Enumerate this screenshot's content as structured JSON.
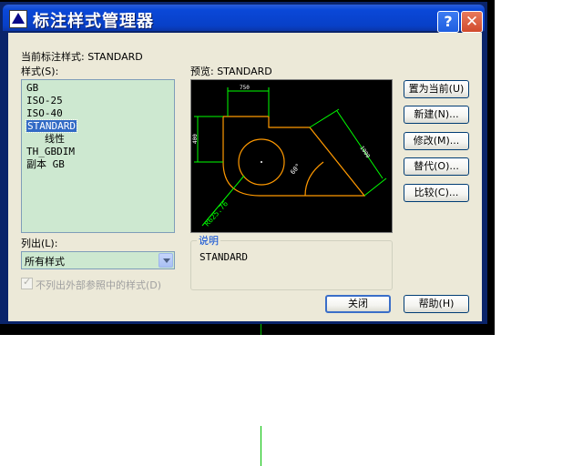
{
  "window": {
    "title": "标注样式管理器",
    "help_glyph": "?",
    "close_glyph": "✕"
  },
  "current_style": {
    "label": "当前标注样式: STANDARD"
  },
  "styles": {
    "label": "样式(S):",
    "items": [
      {
        "text": "GB"
      },
      {
        "text": "ISO-25"
      },
      {
        "text": "ISO-40"
      },
      {
        "text": "STANDARD",
        "selected": true
      },
      {
        "text": "线性",
        "child": true
      },
      {
        "text": "TH_GBDIM"
      },
      {
        "text": "副本 GB"
      }
    ]
  },
  "list_filter": {
    "label": "列出(L):",
    "selected": "所有样式"
  },
  "exclude_xref": {
    "label": "不列出外部参照中的样式(D)",
    "checked": true,
    "enabled": false
  },
  "preview": {
    "label": "预览: STANDARD",
    "dims": {
      "top": "750",
      "left": "400",
      "right": "1000",
      "angle": "60°",
      "radius": "R625.76"
    }
  },
  "description": {
    "title": "说明",
    "text": "STANDARD"
  },
  "buttons": {
    "set_current": "置为当前(U)",
    "new": "新建(N)...",
    "modify": "修改(M)...",
    "override": "替代(O)...",
    "compare": "比较(C)...",
    "close": "关闭",
    "help": "帮助(H)"
  },
  "colors": {
    "list_bg": "#cde8d0",
    "selection": "#316ac5",
    "preview_outline": "#ff9900",
    "preview_dim": "#00ff00",
    "preview_text_blue": "#6060ff"
  }
}
